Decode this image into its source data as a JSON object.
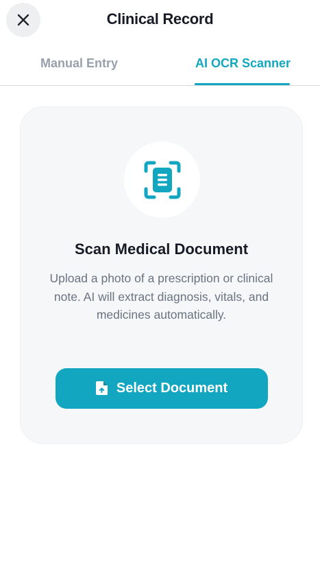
{
  "header": {
    "title": "Clinical Record",
    "close_icon": "close-icon"
  },
  "tabs": [
    {
      "label": "Manual Entry",
      "active": false
    },
    {
      "label": "AI OCR Scanner",
      "active": true
    }
  ],
  "scanner": {
    "icon": "document-scan-icon",
    "title": "Scan Medical Document",
    "description": "Upload a photo of a prescription or clinical note. AI will extract diagnosis, vitals, and medicines automatically.",
    "button_label": "Select Document",
    "button_icon": "file-upload-icon"
  },
  "colors": {
    "accent": "#12a6c0",
    "card_background": "#f6f7f9",
    "title_text": "#161b26",
    "muted_text": "#6a7381",
    "inactive_tab": "#97a0ab"
  }
}
